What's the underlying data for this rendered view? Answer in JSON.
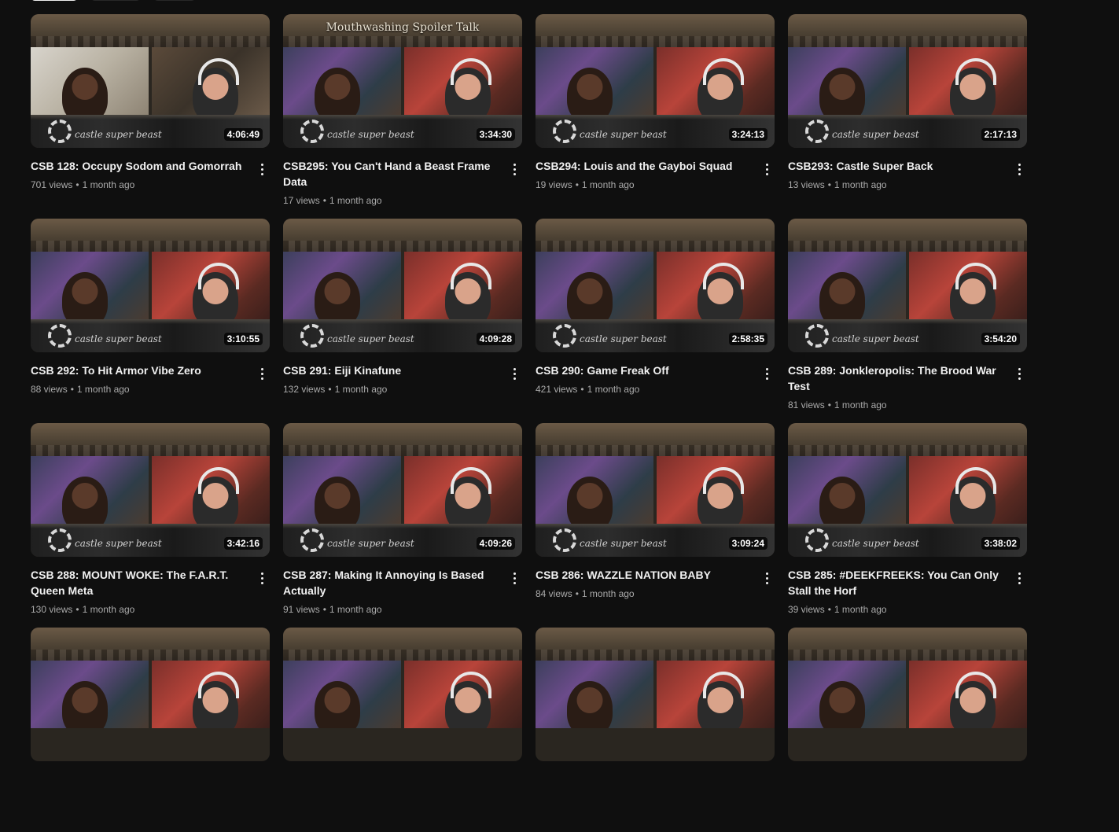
{
  "videos": [
    {
      "title": "CSB 128: Occupy Sodom and Gomorrah",
      "views": "701 views",
      "age": "1 month ago",
      "duration": "4:06:49",
      "banner_text": "",
      "logo_text": "castle super beast",
      "light": true
    },
    {
      "title": "CSB295: You Can't Hand a Beast Frame Data",
      "views": "17 views",
      "age": "1 month ago",
      "duration": "3:34:30",
      "banner_text": "Mouthwashing Spoiler Talk",
      "logo_text": "castle super beast",
      "light": false
    },
    {
      "title": "CSB294: Louis and the Gayboi Squad",
      "views": "19 views",
      "age": "1 month ago",
      "duration": "3:24:13",
      "banner_text": "",
      "logo_text": "castle super beast",
      "light": false
    },
    {
      "title": "CSB293: Castle Super Back",
      "views": "13 views",
      "age": "1 month ago",
      "duration": "2:17:13",
      "banner_text": "",
      "logo_text": "castle super beast",
      "light": false
    },
    {
      "title": "CSB 292: To Hit Armor Vibe Zero",
      "views": "88 views",
      "age": "1 month ago",
      "duration": "3:10:55",
      "banner_text": "",
      "logo_text": "castle super beast",
      "light": false
    },
    {
      "title": "CSB 291: Eiji Kinafune",
      "views": "132 views",
      "age": "1 month ago",
      "duration": "4:09:28",
      "banner_text": "",
      "logo_text": "castle super beast",
      "light": false
    },
    {
      "title": "CSB 290: Game Freak Off",
      "views": "421 views",
      "age": "1 month ago",
      "duration": "2:58:35",
      "banner_text": "",
      "logo_text": "castle super beast",
      "light": false
    },
    {
      "title": "CSB 289: Jonkleropolis: The Brood War Test",
      "views": "81 views",
      "age": "1 month ago",
      "duration": "3:54:20",
      "banner_text": "",
      "logo_text": "castle super beast",
      "light": false
    },
    {
      "title": "CSB 288: MOUNT WOKE: The F.A.R.T. Queen Meta",
      "views": "130 views",
      "age": "1 month ago",
      "duration": "3:42:16",
      "banner_text": "",
      "logo_text": "castle super beast",
      "light": false
    },
    {
      "title": "CSB 287: Making It Annoying Is Based Actually",
      "views": "91 views",
      "age": "1 month ago",
      "duration": "4:09:26",
      "banner_text": "",
      "logo_text": "castle super beast",
      "light": false
    },
    {
      "title": "CSB 286: WAZZLE NATION BABY",
      "views": "84 views",
      "age": "1 month ago",
      "duration": "3:09:24",
      "banner_text": "",
      "logo_text": "castle super beast",
      "light": false
    },
    {
      "title": "CSB 285: #DEEKFREEKS: You Can Only Stall the Horf",
      "views": "39 views",
      "age": "1 month ago",
      "duration": "3:38:02",
      "banner_text": "",
      "logo_text": "castle super beast",
      "light": false
    },
    {
      "title": "",
      "views": "",
      "age": "",
      "duration": "",
      "banner_text": "",
      "logo_text": "",
      "light": false
    },
    {
      "title": "",
      "views": "",
      "age": "",
      "duration": "",
      "banner_text": "",
      "logo_text": "",
      "light": false
    },
    {
      "title": "",
      "views": "",
      "age": "",
      "duration": "",
      "banner_text": "",
      "logo_text": "",
      "light": false
    },
    {
      "title": "",
      "views": "",
      "age": "",
      "duration": "",
      "banner_text": "",
      "logo_text": "",
      "light": false
    }
  ],
  "stats_separator": "•",
  "icons": {
    "menu": "more-vert-icon",
    "logo": "castle-super-beast-logo-icon"
  }
}
